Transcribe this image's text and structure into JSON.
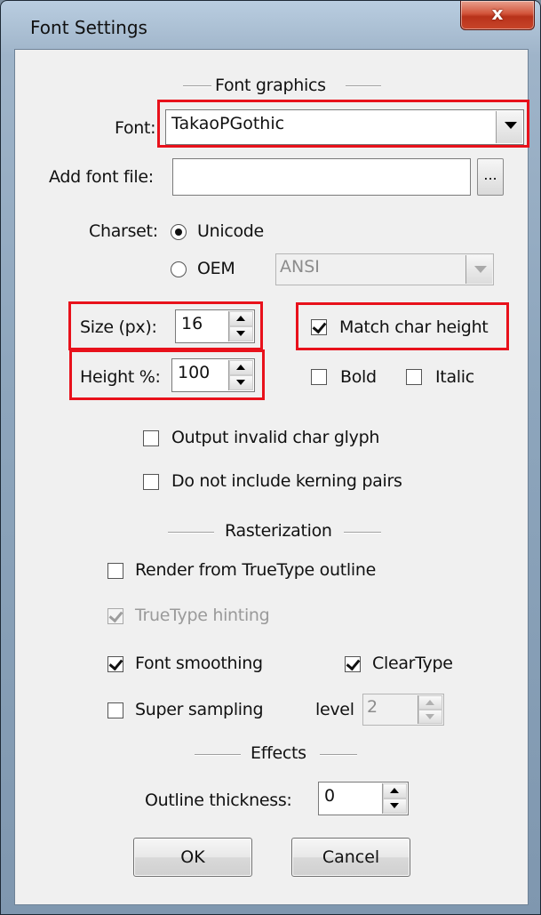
{
  "window": {
    "title": "Font Settings",
    "close_glyph": "x"
  },
  "groups": {
    "font_graphics": "Font graphics",
    "rasterization": "Rasterization",
    "effects": "Effects"
  },
  "font": {
    "label": "Font:",
    "value": "TakaoPGothic"
  },
  "add_font_file": {
    "label": "Add font file:",
    "value": "",
    "browse_label": "..."
  },
  "charset": {
    "label": "Charset:",
    "options": [
      "Unicode",
      "OEM"
    ],
    "selected": "Unicode",
    "oem_codepage": "ANSI"
  },
  "size": {
    "label": "Size (px):",
    "value": "16"
  },
  "height": {
    "label": "Height %:",
    "value": "100"
  },
  "checkboxes": {
    "match_char_height": {
      "label": "Match char height",
      "checked": true
    },
    "bold": {
      "label": "Bold",
      "checked": false
    },
    "italic": {
      "label": "Italic",
      "checked": false
    },
    "output_invalid_char_glyph": {
      "label": "Output invalid char glyph",
      "checked": false
    },
    "do_not_include_kerning_pairs": {
      "label": "Do not include kerning pairs",
      "checked": false
    },
    "render_from_truetype_outline": {
      "label": "Render from TrueType outline",
      "checked": false
    },
    "truetype_hinting": {
      "label": "TrueType hinting",
      "checked": true,
      "disabled": true
    },
    "font_smoothing": {
      "label": "Font smoothing",
      "checked": true
    },
    "cleartype": {
      "label": "ClearType",
      "checked": true
    },
    "super_sampling": {
      "label": "Super sampling",
      "checked": false
    }
  },
  "supersampling_level": {
    "label": "level",
    "value": "2"
  },
  "outline_thickness": {
    "label": "Outline thickness:",
    "value": "0"
  },
  "buttons": {
    "ok": "OK",
    "cancel": "Cancel"
  },
  "colors": {
    "highlight": "#e8111b",
    "dialog_bg": "#f0f0f0",
    "close_button": "#c8452a"
  }
}
